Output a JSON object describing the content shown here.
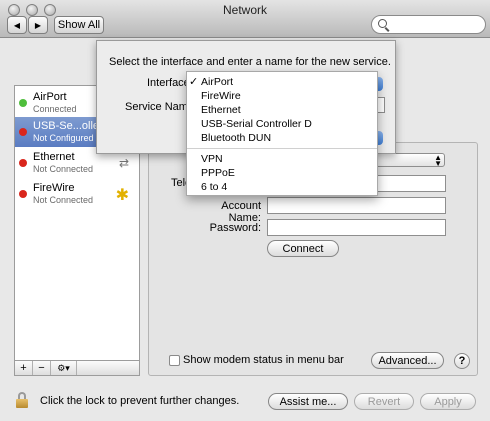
{
  "window": {
    "title": "Network"
  },
  "toolbar": {
    "back": "◀",
    "forward": "▶",
    "show_all": "Show All",
    "search_placeholder": ""
  },
  "sidebar": {
    "items": [
      {
        "name": "AirPort",
        "status": "Connected",
        "status_color": "#4fbe3c"
      },
      {
        "name": "USB-Se...oller",
        "status": "Not Configured",
        "status_color": "#d9261c"
      },
      {
        "name": "Ethernet",
        "status": "Not Connected",
        "status_color": "#d9261c"
      },
      {
        "name": "FireWire",
        "status": "Not Connected",
        "status_color": "#d9261c"
      }
    ],
    "add": "+",
    "remove": "−",
    "action": "⚙▾"
  },
  "sheet": {
    "message": "Select the interface and enter a name for the new service.",
    "interface_label": "Interface",
    "service_name_label": "Service Name"
  },
  "interface_menu": {
    "selected": "AirPort",
    "check": "✓",
    "group1": [
      "AirPort",
      "FireWire",
      "Ethernet",
      "USB-Serial Controller D",
      "Bluetooth DUN"
    ],
    "group2": [
      "VPN",
      "PPPoE",
      "6 to 4"
    ]
  },
  "panel": {
    "telephone_label": "Tele",
    "account_name_label": "Account Name:",
    "password_label": "Password:",
    "connect": "Connect",
    "show_modem_status": "Show modem status in menu bar",
    "advanced": "Advanced...",
    "help": "?"
  },
  "footer": {
    "lock_text": "Click the lock to prevent further changes.",
    "assist": "Assist me...",
    "revert": "Revert",
    "apply": "Apply"
  }
}
